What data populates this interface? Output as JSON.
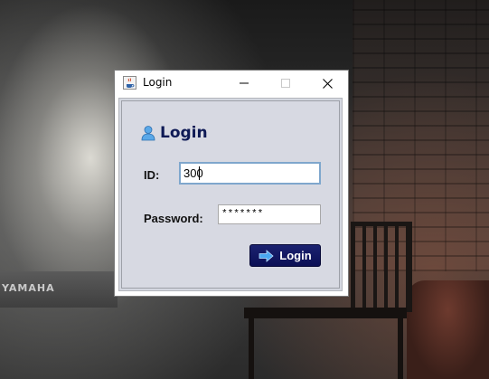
{
  "desktop": {
    "piano_brand": "YAMAHA"
  },
  "window": {
    "title": "Login",
    "icon": "java-cup-icon",
    "controls": [
      "minimize",
      "maximize",
      "close"
    ]
  },
  "form": {
    "heading": "Login",
    "heading_icon": "user-icon",
    "id_label": "ID:",
    "id_value": "300",
    "password_label": "Password:",
    "password_value": "*******",
    "login_button_label": "Login",
    "login_button_icon": "arrow-right-icon"
  },
  "colors": {
    "heading": "#0e1a55",
    "button_bg": "#0b0f55",
    "panel_bg": "#d4d7e0",
    "id_field_focus_border": "#7fa7cd",
    "arrow_icon": "#49a8f0"
  }
}
